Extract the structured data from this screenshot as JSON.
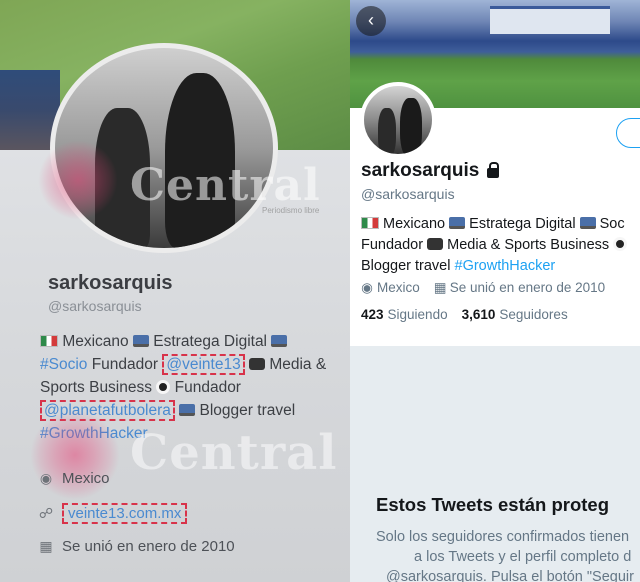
{
  "left": {
    "name": "sarkosarquis",
    "handle": "@sarkosarquis",
    "bio": {
      "country": "Mexicano",
      "strategist": "Estratega Digital",
      "socio_tag": "#Socio",
      "fundador": " Fundador ",
      "veinte13": "@veinte13",
      "media": " Media &",
      "sports": "Sports Business",
      "fundador2": " Fundador",
      "planeta": "@planetafutbolera",
      "blogger": " Blogger travel",
      "hashtag": "#GrowthHacker"
    },
    "location": "Mexico",
    "website": "veinte13.com.mx",
    "joined": "Se unió en enero de 2010"
  },
  "watermark": {
    "brand": "Central",
    "tagline": "Periodismo libre"
  },
  "right": {
    "back_icon": "‹",
    "name": "sarkosarquis",
    "handle": "@sarkosarquis",
    "bio": {
      "country": "Mexicano",
      "strategist": "Estratega Digital",
      "socio": "Soc",
      "fundador": "Fundador",
      "media": "Media & Sports Business",
      "blogger": "Blogger travel",
      "hashtag": "#GrowthHacker"
    },
    "location": "Mexico",
    "joined": "Se unió en enero de 2010",
    "following_count": "423",
    "following_label": "Siguiendo",
    "followers_count": "3,610",
    "followers_label": "Seguidores",
    "protected_title": "Estos Tweets están proteg",
    "protected_line1": "Solo los seguidores confirmados tienen",
    "protected_line2": "a los Tweets y el perfil completo d",
    "protected_line3": "@sarkosarquis. Pulsa el botón \"Seguir"
  }
}
